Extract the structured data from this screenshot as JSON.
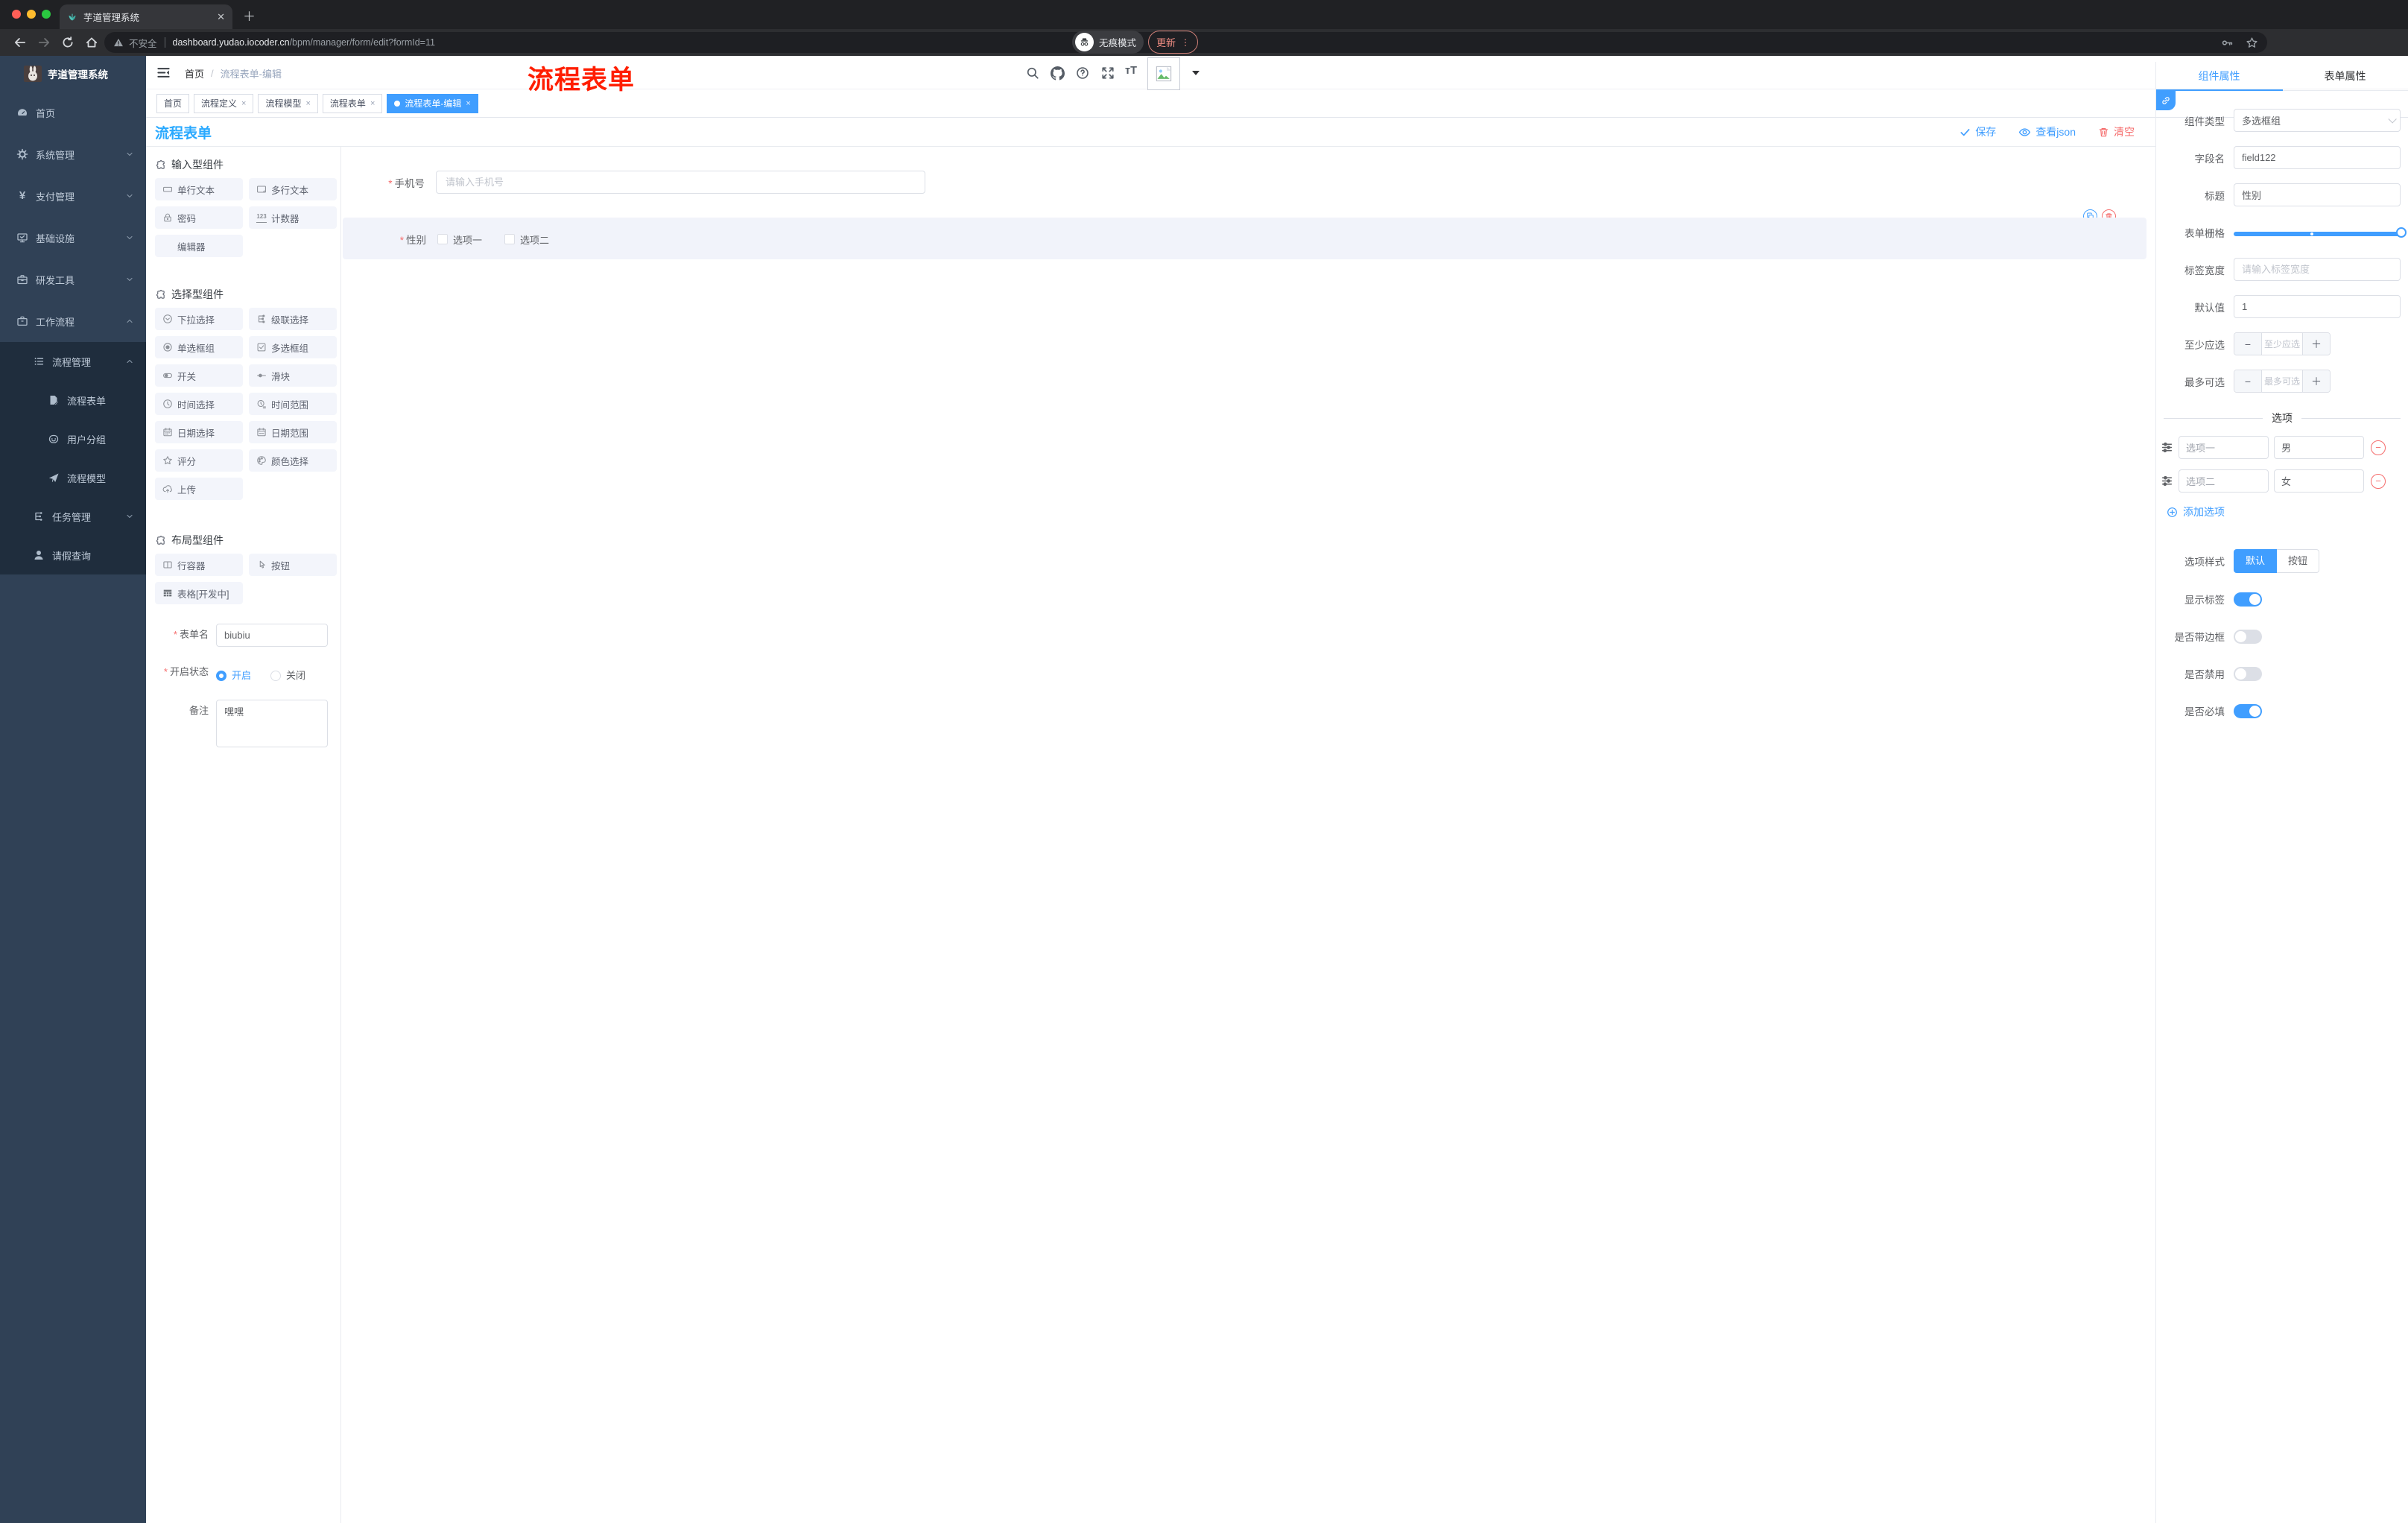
{
  "browser": {
    "tab_title": "芋道管理系统",
    "security_label": "不安全",
    "url_domain": "dashboard.yudao.iocoder.cn",
    "url_path": "/bpm/manager/form/edit?formId=11",
    "incognito_label": "无痕模式",
    "update_label": "更新"
  },
  "sidebar": {
    "logo_title": "芋道管理系统",
    "items": [
      {
        "label": "首页"
      },
      {
        "label": "系统管理"
      },
      {
        "label": "支付管理"
      },
      {
        "label": "基础设施"
      },
      {
        "label": "研发工具"
      },
      {
        "label": "工作流程"
      },
      {
        "label": "流程管理"
      },
      {
        "label": "流程表单"
      },
      {
        "label": "用户分组"
      },
      {
        "label": "流程模型"
      },
      {
        "label": "任务管理"
      },
      {
        "label": "请假查询"
      }
    ]
  },
  "header": {
    "breadcrumb_home": "首页",
    "breadcrumb_current": "流程表单-编辑",
    "annotation": "流程表单"
  },
  "tabbar": {
    "tabs": [
      "首页",
      "流程定义",
      "流程模型",
      "流程表单",
      "流程表单-编辑"
    ]
  },
  "content": {
    "title": "流程表单",
    "save_label": "保存",
    "view_json_label": "查看json",
    "clear_label": "清空"
  },
  "components": {
    "group_input_title": "输入型组件",
    "group_select_title": "选择型组件",
    "group_layout_title": "布局型组件",
    "input_items": [
      "单行文本",
      "多行文本",
      "密码",
      "计数器",
      "编辑器"
    ],
    "select_items": [
      "下拉选择",
      "级联选择",
      "单选框组",
      "多选框组",
      "开关",
      "滑块",
      "时间选择",
      "时间范围",
      "日期选择",
      "日期范围",
      "评分",
      "颜色选择",
      "上传"
    ],
    "layout_items": [
      "行容器",
      "按钮",
      "表格[开发中]"
    ]
  },
  "form_settings": {
    "form_name_label": "表单名",
    "form_name_value": "biubiu",
    "status_label": "开启状态",
    "status_on": "开启",
    "status_off": "关闭",
    "remark_label": "备注",
    "remark_value": "嘿嘿"
  },
  "canvas": {
    "phone_label": "手机号",
    "phone_placeholder": "请输入手机号",
    "gender_label": "性别",
    "gender_option1": "选项一",
    "gender_option2": "选项二"
  },
  "props": {
    "tab_component": "组件属性",
    "tab_form": "表单属性",
    "component_type_label": "组件类型",
    "component_type_value": "多选框组",
    "field_name_label": "字段名",
    "field_name_value": "field122",
    "title_label": "标题",
    "title_value": "性别",
    "grid_label": "表单栅格",
    "label_width_label": "标签宽度",
    "label_width_placeholder": "请输入标签宽度",
    "default_label": "默认值",
    "default_value": "1",
    "min_label": "至少应选",
    "min_placeholder": "至少应选",
    "max_label": "最多可选",
    "max_placeholder": "最多可选",
    "options_divider": "选项",
    "options": [
      {
        "label": "选项一",
        "value": "男"
      },
      {
        "label": "选项二",
        "value": "女"
      }
    ],
    "add_option_label": "添加选项",
    "option_style_label": "选项样式",
    "option_style_default": "默认",
    "option_style_button": "按钮",
    "show_label_label": "显示标签",
    "border_label": "是否带边框",
    "disabled_label": "是否禁用",
    "required_label": "是否必填"
  },
  "colors": {
    "primary": "#409eff",
    "title_blue": "#29a9ff",
    "danger": "#f56c6c",
    "annotation_red": "#ff1e00",
    "sidebar_bg": "#304156",
    "sidebar_submenu_bg": "#1f2d3d"
  }
}
